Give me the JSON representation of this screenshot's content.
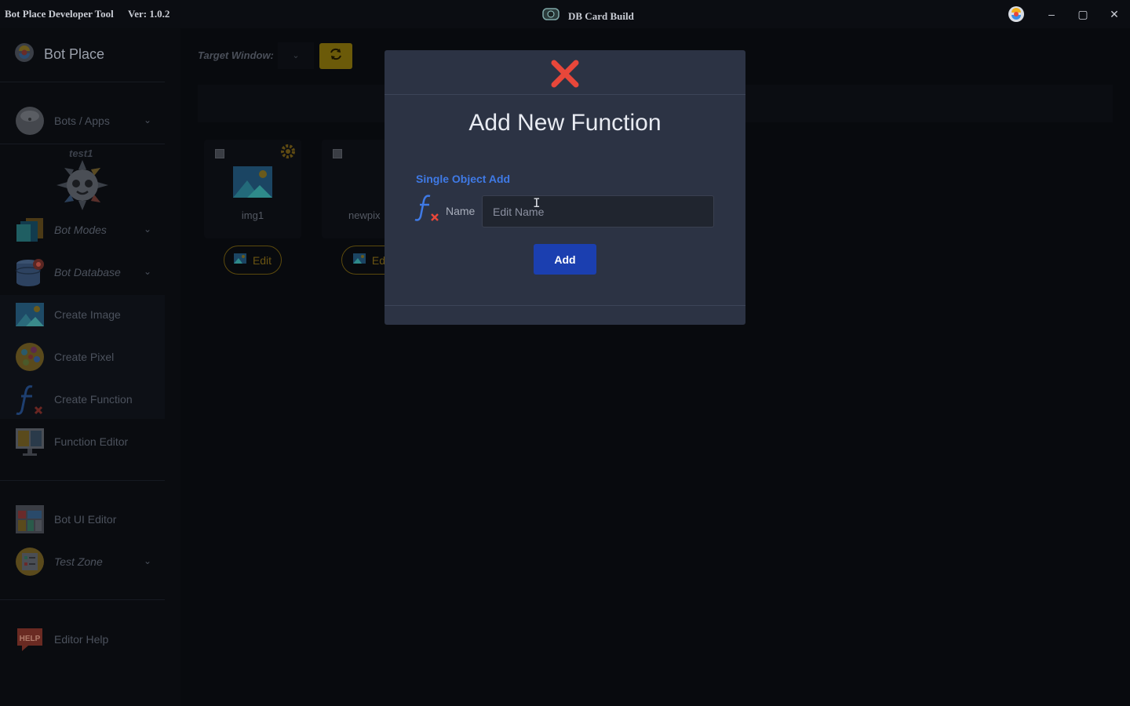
{
  "titlebar": {
    "app_title": "Bot Place Developer Tool",
    "version": "Ver: 1.0.2",
    "window_title": "DB Card Build",
    "minimize_glyph": "–",
    "maximize_glyph": "▢",
    "close_glyph": "✕"
  },
  "sidebar": {
    "brand": "Bot Place",
    "user_name": "test1",
    "items": [
      {
        "label": "Bots / Apps",
        "icon": "avatar-sphere-icon"
      },
      {
        "label": "Bot Modes",
        "icon": "bot-modes-icon"
      },
      {
        "label": "Bot Database",
        "icon": "database-icon"
      },
      {
        "label": "Create Image",
        "icon": "image-icon"
      },
      {
        "label": "Create Pixel",
        "icon": "pixel-icon"
      },
      {
        "label": "Create Function",
        "icon": "function-icon"
      },
      {
        "label": "Function Editor",
        "icon": "code-monitor-icon"
      },
      {
        "label": "Bot UI Editor",
        "icon": "ui-editor-icon"
      },
      {
        "label": "Test Zone",
        "icon": "checklist-icon"
      },
      {
        "label": "Editor Help",
        "icon": "help-icon"
      }
    ]
  },
  "main": {
    "target_window_label": "Target Window:",
    "cards": [
      {
        "name": "img1",
        "edit_label": "Edit"
      },
      {
        "name": "newpix",
        "edit_label": "Edi"
      }
    ]
  },
  "modal": {
    "title": "Add New Function",
    "section": "Single Object Add",
    "name_label": "Name",
    "name_placeholder": "Edit Name",
    "add_label": "Add"
  },
  "colors": {
    "accent_blue": "#1b3fb0",
    "section_blue": "#3f7ae6",
    "close_red": "#e8473a",
    "refresh_gold": "#6b5a09"
  }
}
